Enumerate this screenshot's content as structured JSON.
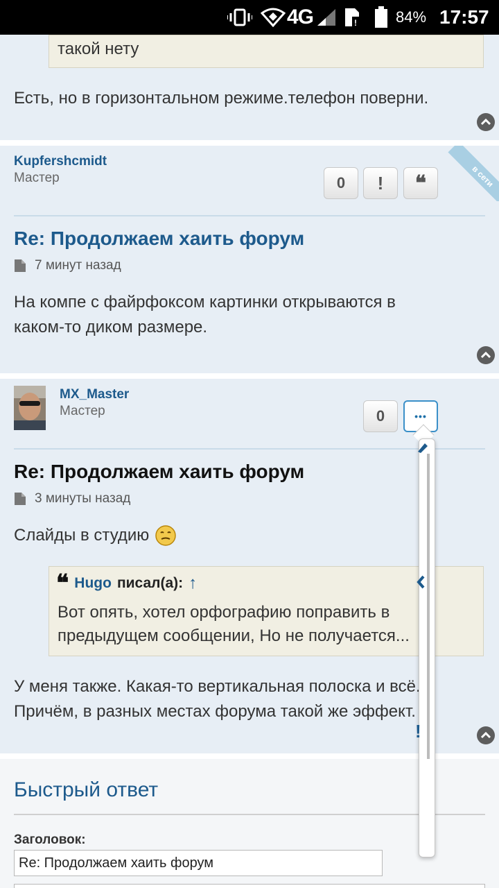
{
  "status_bar": {
    "network": "4G",
    "battery_percent": "84%",
    "time": "17:57"
  },
  "prev_post": {
    "quote_text": "такой нету",
    "body": "Есть, но в горизонтальном режиме.телефон поверни."
  },
  "post1": {
    "username": "Kupfershcmidt",
    "rank": "Мастер",
    "online_badge": "в сети",
    "reputation": "0",
    "report_label": "!",
    "quote_label": "❝",
    "title": "Re: Продолжаем хаить форум",
    "time": "7 минут назад",
    "body_line1": "На компе с файрфоксом картинки открываются в",
    "body_line2": "каком-то диком размере."
  },
  "post2": {
    "username": "MX_Master",
    "rank": "Мастер",
    "reputation": "0",
    "more_label": "•••",
    "title": "Re: Продолжаем хаить форум",
    "time": "3 минуты назад",
    "body_text": "Слайды в студию",
    "quote": {
      "author": "Hugo",
      "wrote": "писал(а):",
      "arrow": "↑",
      "line1": "Вот опять, хотел орфографию поправить в",
      "line2": "предыдущем сообщении, Но не получается..."
    },
    "reply_line1": "У меня также. Какая-то вертикальная полоска и всё.",
    "reply_line2": "Причём, в разных местах форума такой же эффект."
  },
  "quick_reply": {
    "title": "Быстрый ответ",
    "subject_label": "Заголовок:",
    "subject_value": "Re: Продолжаем хаить форум"
  },
  "colors": {
    "post_bg": "#e7eef5",
    "link": "#1d5a8c",
    "quote_bg": "#f1efe3"
  }
}
